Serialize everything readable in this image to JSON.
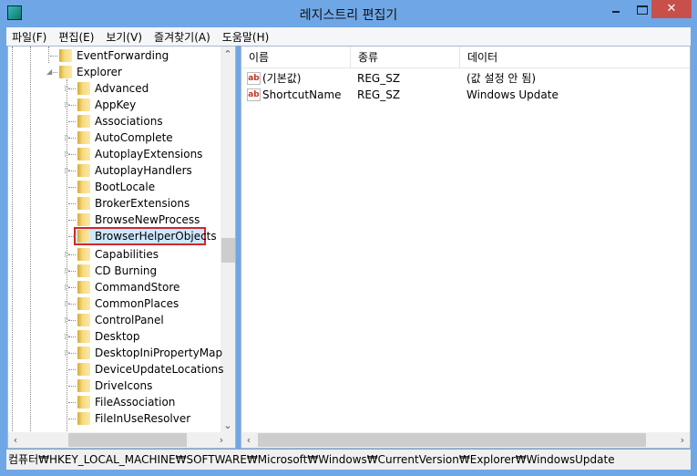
{
  "window": {
    "title": "레지스트리 편집기",
    "close": "✕"
  },
  "menu": [
    "파일(F)",
    "편집(E)",
    "보기(V)",
    "즐겨찾기(A)",
    "도움말(H)"
  ],
  "tree": {
    "parent_items": [
      {
        "label": "EventForwarding",
        "expandable": false
      },
      {
        "label": "Explorer",
        "expanded": true
      }
    ],
    "children": [
      {
        "label": "Advanced",
        "expandable": true
      },
      {
        "label": "AppKey",
        "expandable": true
      },
      {
        "label": "Associations",
        "expandable": false
      },
      {
        "label": "AutoComplete",
        "expandable": true
      },
      {
        "label": "AutoplayExtensions",
        "expandable": true
      },
      {
        "label": "AutoplayHandlers",
        "expandable": true
      },
      {
        "label": "BootLocale",
        "expandable": false
      },
      {
        "label": "BrokerExtensions",
        "expandable": false
      },
      {
        "label": "BrowseNewProcess",
        "expandable": false
      },
      {
        "label": "BrowserHelperObjects",
        "expandable": false,
        "selected": true
      },
      {
        "label": "Capabilities",
        "expandable": true
      },
      {
        "label": "CD Burning",
        "expandable": true
      },
      {
        "label": "CommandStore",
        "expandable": true
      },
      {
        "label": "CommonPlaces",
        "expandable": true
      },
      {
        "label": "ControlPanel",
        "expandable": true
      },
      {
        "label": "Desktop",
        "expandable": true
      },
      {
        "label": "DesktopIniPropertyMap",
        "expandable": true
      },
      {
        "label": "DeviceUpdateLocations",
        "expandable": false
      },
      {
        "label": "DriveIcons",
        "expandable": false
      },
      {
        "label": "FileAssociation",
        "expandable": false
      },
      {
        "label": "FileInUseResolver",
        "expandable": false
      }
    ],
    "highlight_color": "#d1282e"
  },
  "values": {
    "columns": [
      "이름",
      "종류",
      "데이터"
    ],
    "rows": [
      {
        "icon": "ab",
        "name": "(기본값)",
        "type": "REG_SZ",
        "data": "(값 설정 안 됨)"
      },
      {
        "icon": "ab",
        "name": "ShortcutName",
        "type": "REG_SZ",
        "data": "Windows Update"
      }
    ]
  },
  "status": "컴퓨터₩HKEY_LOCAL_MACHINE₩SOFTWARE₩Microsoft₩Windows₩CurrentVersion₩Explorer₩WindowsUpdate"
}
